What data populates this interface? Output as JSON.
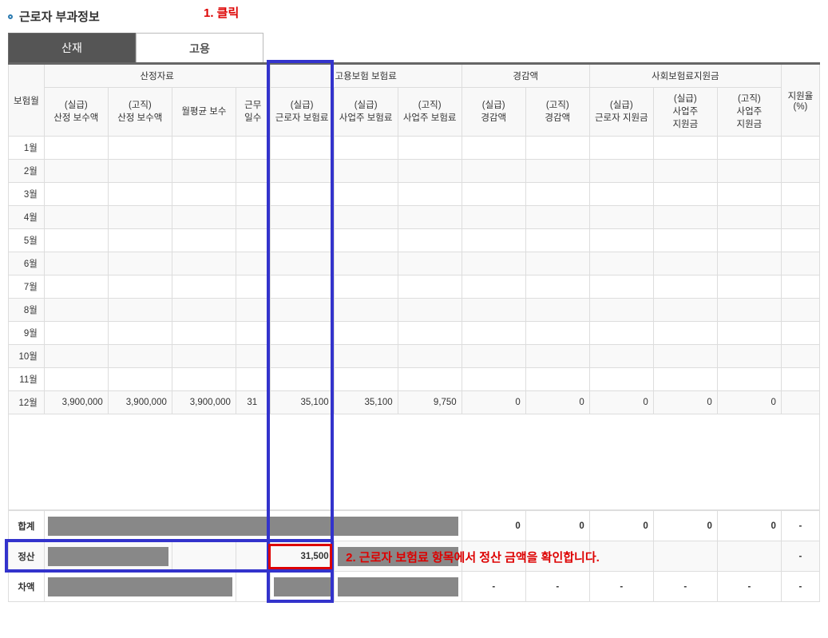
{
  "section": {
    "title": "근로자 부과정보"
  },
  "annotations": {
    "click": "1. 클릭",
    "check": "2. 근로자 보험료 항목에서 정산 금액을 확인합니다."
  },
  "tabs": {
    "inactive": "산재",
    "active": "고용"
  },
  "header_groups": {
    "g1": "산정자료",
    "g2": "고용보험 보험료",
    "g3": "경감액",
    "g4": "사회보험료지원금"
  },
  "columns": {
    "month": "보험월",
    "c1": "(실급)\n산정 보수액",
    "c2": "(고직)\n산정 보수액",
    "c3": "월평균 보수",
    "c4": "근무\n일수",
    "c5": "(실급)\n근로자 보험료",
    "c6": "(실급)\n사업주 보험료",
    "c7": "(고직)\n사업주 보험료",
    "c8": "(실급)\n경감액",
    "c9": "(고직)\n경감액",
    "c10": "(실급)\n근로자 지원금",
    "c11": "(실급)\n사업주\n지원금",
    "c12": "(고직)\n사업주\n지원금",
    "c13": "지원율\n(%)"
  },
  "months": [
    "1월",
    "2월",
    "3월",
    "4월",
    "5월",
    "6월",
    "7월",
    "8월",
    "9월",
    "10월",
    "11월",
    "12월"
  ],
  "rows": [
    {
      "v1": "",
      "v2": "",
      "v3": "",
      "v4": "",
      "v5": "",
      "v6": "",
      "v7": "",
      "v8": "",
      "v9": "",
      "v10": "",
      "v11": "",
      "v12": "",
      "v13": ""
    },
    {
      "v1": "",
      "v2": "",
      "v3": "",
      "v4": "",
      "v5": "",
      "v6": "",
      "v7": "",
      "v8": "",
      "v9": "",
      "v10": "",
      "v11": "",
      "v12": "",
      "v13": ""
    },
    {
      "v1": "",
      "v2": "",
      "v3": "",
      "v4": "",
      "v5": "",
      "v6": "",
      "v7": "",
      "v8": "",
      "v9": "",
      "v10": "",
      "v11": "",
      "v12": "",
      "v13": ""
    },
    {
      "v1": "",
      "v2": "",
      "v3": "",
      "v4": "",
      "v5": "",
      "v6": "",
      "v7": "",
      "v8": "",
      "v9": "",
      "v10": "",
      "v11": "",
      "v12": "",
      "v13": ""
    },
    {
      "v1": "",
      "v2": "",
      "v3": "",
      "v4": "",
      "v5": "",
      "v6": "",
      "v7": "",
      "v8": "",
      "v9": "",
      "v10": "",
      "v11": "",
      "v12": "",
      "v13": ""
    },
    {
      "v1": "",
      "v2": "",
      "v3": "",
      "v4": "",
      "v5": "",
      "v6": "",
      "v7": "",
      "v8": "",
      "v9": "",
      "v10": "",
      "v11": "",
      "v12": "",
      "v13": ""
    },
    {
      "v1": "",
      "v2": "",
      "v3": "",
      "v4": "",
      "v5": "",
      "v6": "",
      "v7": "",
      "v8": "",
      "v9": "",
      "v10": "",
      "v11": "",
      "v12": "",
      "v13": ""
    },
    {
      "v1": "",
      "v2": "",
      "v3": "",
      "v4": "",
      "v5": "",
      "v6": "",
      "v7": "",
      "v8": "",
      "v9": "",
      "v10": "",
      "v11": "",
      "v12": "",
      "v13": ""
    },
    {
      "v1": "",
      "v2": "",
      "v3": "",
      "v4": "",
      "v5": "",
      "v6": "",
      "v7": "",
      "v8": "",
      "v9": "",
      "v10": "",
      "v11": "",
      "v12": "",
      "v13": ""
    },
    {
      "v1": "",
      "v2": "",
      "v3": "",
      "v4": "",
      "v5": "",
      "v6": "",
      "v7": "",
      "v8": "",
      "v9": "",
      "v10": "",
      "v11": "",
      "v12": "",
      "v13": ""
    },
    {
      "v1": "",
      "v2": "",
      "v3": "",
      "v4": "",
      "v5": "",
      "v6": "",
      "v7": "",
      "v8": "",
      "v9": "",
      "v10": "",
      "v11": "",
      "v12": "",
      "v13": ""
    },
    {
      "v1": "3,900,000",
      "v2": "3,900,000",
      "v3": "3,900,000",
      "v4": "31",
      "v5": "35,100",
      "v6": "35,100",
      "v7": "9,750",
      "v8": "0",
      "v9": "0",
      "v10": "0",
      "v11": "0",
      "v12": "0",
      "v13": ""
    }
  ],
  "summary": {
    "total_label": "합계",
    "total": {
      "v8": "0",
      "v9": "0",
      "v10": "0",
      "v11": "0",
      "v12": "0",
      "v13": "-"
    },
    "settle_label": "정산",
    "settle": {
      "v5": "31,500",
      "v13": "-"
    },
    "diff_label": "차액",
    "diff": {
      "v8": "-",
      "v9": "-",
      "v10": "-",
      "v11": "-",
      "v12": "-",
      "v13": "-"
    }
  }
}
